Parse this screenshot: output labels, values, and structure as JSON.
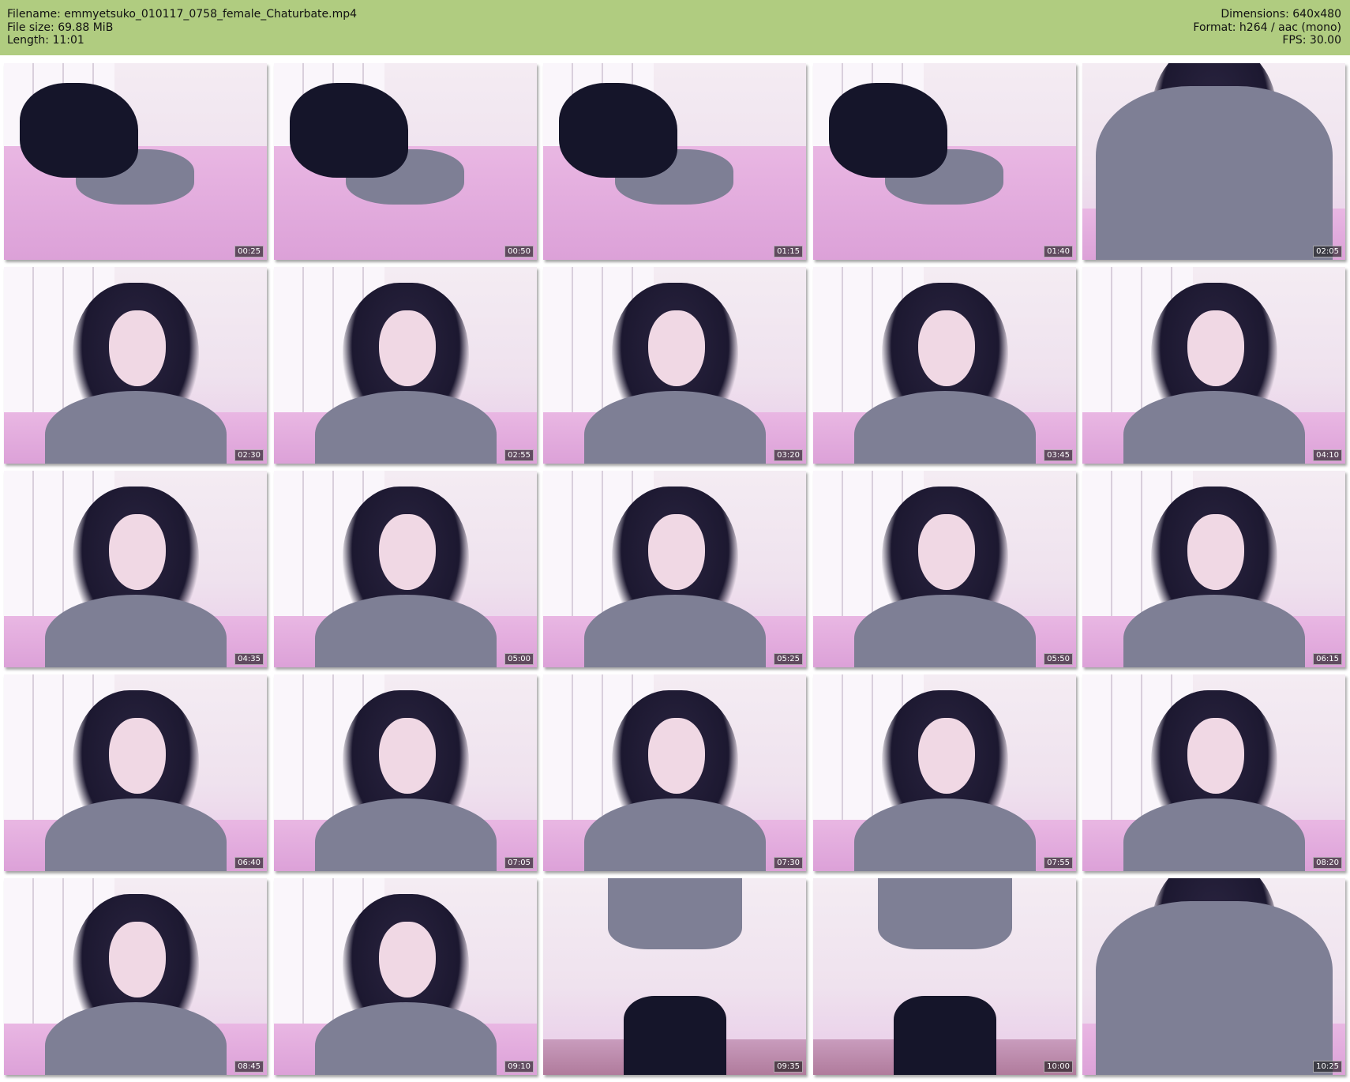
{
  "header": {
    "left": [
      "Filename: emmyetsuko_010117_0758_female_Chaturbate.mp4",
      "File size: 69.88 MiB",
      "Length: 11:01"
    ],
    "right": [
      "Dimensions: 640x480",
      "Format: h264 / aac (mono)",
      "FPS: 30.00"
    ],
    "background_color": "#b0cc80"
  },
  "thumbnails": [
    {
      "time": "00:25",
      "scene": "lying"
    },
    {
      "time": "00:50",
      "scene": "lying"
    },
    {
      "time": "01:15",
      "scene": "lying"
    },
    {
      "time": "01:40",
      "scene": "lying"
    },
    {
      "time": "02:05",
      "scene": "close"
    },
    {
      "time": "02:30",
      "scene": "portrait"
    },
    {
      "time": "02:55",
      "scene": "portrait"
    },
    {
      "time": "03:20",
      "scene": "portrait"
    },
    {
      "time": "03:45",
      "scene": "portrait"
    },
    {
      "time": "04:10",
      "scene": "portrait"
    },
    {
      "time": "04:35",
      "scene": "portrait"
    },
    {
      "time": "05:00",
      "scene": "portrait"
    },
    {
      "time": "05:25",
      "scene": "portrait"
    },
    {
      "time": "05:50",
      "scene": "portrait"
    },
    {
      "time": "06:15",
      "scene": "portrait"
    },
    {
      "time": "06:40",
      "scene": "portrait"
    },
    {
      "time": "07:05",
      "scene": "portrait"
    },
    {
      "time": "07:30",
      "scene": "portrait"
    },
    {
      "time": "07:55",
      "scene": "portrait"
    },
    {
      "time": "08:20",
      "scene": "portrait"
    },
    {
      "time": "08:45",
      "scene": "portrait"
    },
    {
      "time": "09:10",
      "scene": "portrait"
    },
    {
      "time": "09:35",
      "scene": "standing"
    },
    {
      "time": "10:00",
      "scene": "standing"
    },
    {
      "time": "10:25",
      "scene": "close"
    }
  ]
}
